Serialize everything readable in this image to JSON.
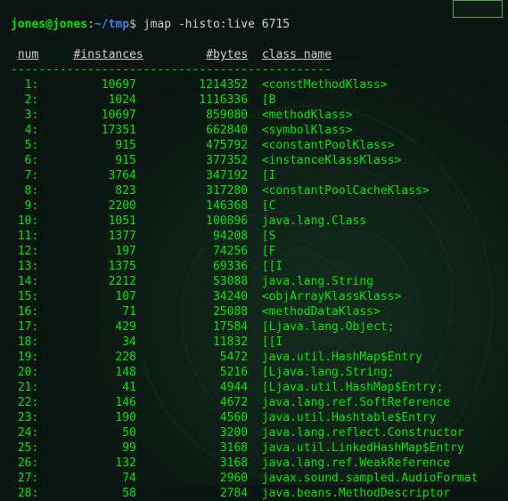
{
  "prompt": {
    "userhost": "jones@jones",
    "path": "~/tmp",
    "dollar": "$",
    "command": "jmap -histo:live 6715"
  },
  "header": {
    "num": "num",
    "instances": "#instances",
    "bytes": "#bytes",
    "classname": "class name"
  },
  "separator": "----------------------------------------------",
  "rows": [
    {
      "n": "1:",
      "i": "10697",
      "b": "1214352",
      "c": "<constMethodKlass>"
    },
    {
      "n": "2:",
      "i": "1024",
      "b": "1116336",
      "c": "[B"
    },
    {
      "n": "3:",
      "i": "10697",
      "b": "859080",
      "c": "<methodKlass>"
    },
    {
      "n": "4:",
      "i": "17351",
      "b": "662840",
      "c": "<symbolKlass>"
    },
    {
      "n": "5:",
      "i": "915",
      "b": "475792",
      "c": "<constantPoolKlass>"
    },
    {
      "n": "6:",
      "i": "915",
      "b": "377352",
      "c": "<instanceKlassKlass>"
    },
    {
      "n": "7:",
      "i": "3764",
      "b": "347192",
      "c": "[I"
    },
    {
      "n": "8:",
      "i": "823",
      "b": "317280",
      "c": "<constantPoolCacheKlass>"
    },
    {
      "n": "9:",
      "i": "2200",
      "b": "146368",
      "c": "[C"
    },
    {
      "n": "10:",
      "i": "1051",
      "b": "100896",
      "c": "java.lang.Class"
    },
    {
      "n": "11:",
      "i": "1377",
      "b": "94208",
      "c": "[S"
    },
    {
      "n": "12:",
      "i": "197",
      "b": "74256",
      "c": "[F"
    },
    {
      "n": "13:",
      "i": "1375",
      "b": "69336",
      "c": "[[I"
    },
    {
      "n": "14:",
      "i": "2212",
      "b": "53088",
      "c": "java.lang.String"
    },
    {
      "n": "15:",
      "i": "107",
      "b": "34240",
      "c": "<objArrayKlassKlass>"
    },
    {
      "n": "16:",
      "i": "71",
      "b": "25088",
      "c": "<methodDataKlass>"
    },
    {
      "n": "17:",
      "i": "429",
      "b": "17584",
      "c": "[Ljava.lang.Object;"
    },
    {
      "n": "18:",
      "i": "34",
      "b": "11832",
      "c": "[[I"
    },
    {
      "n": "19:",
      "i": "228",
      "b": "5472",
      "c": "java.util.HashMap$Entry"
    },
    {
      "n": "20:",
      "i": "148",
      "b": "5216",
      "c": "[Ljava.lang.String;"
    },
    {
      "n": "21:",
      "i": "41",
      "b": "4944",
      "c": "[Ljava.util.HashMap$Entry;"
    },
    {
      "n": "22:",
      "i": "146",
      "b": "4672",
      "c": "java.lang.ref.SoftReference"
    },
    {
      "n": "23:",
      "i": "190",
      "b": "4560",
      "c": "java.util.Hashtable$Entry"
    },
    {
      "n": "24:",
      "i": "50",
      "b": "3200",
      "c": "java.lang.reflect.Constructor"
    },
    {
      "n": "25:",
      "i": "99",
      "b": "3168",
      "c": "java.util.LinkedHashMap$Entry"
    },
    {
      "n": "26:",
      "i": "132",
      "b": "3168",
      "c": "java.lang.ref.WeakReference"
    },
    {
      "n": "27:",
      "i": "74",
      "b": "2960",
      "c": "javax.sound.sampled.AudioFormat"
    },
    {
      "n": "28:",
      "i": "58",
      "b": "2784",
      "c": "java.beans.MethodDescriptor"
    }
  ]
}
